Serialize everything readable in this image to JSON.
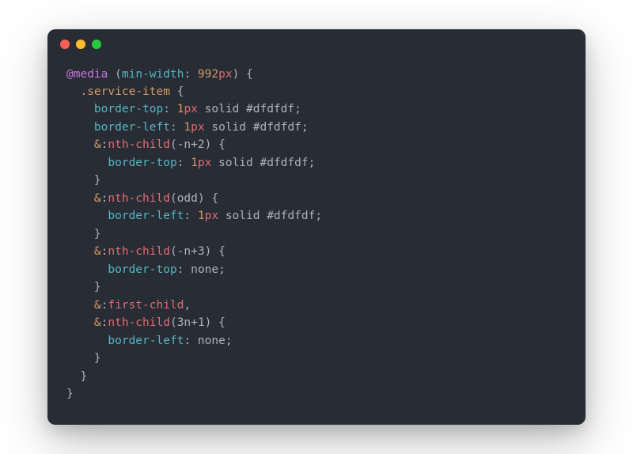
{
  "code": {
    "language": "scss",
    "tokens": [
      [
        [
          "tok-at",
          "@media"
        ],
        [
          "tok-punc",
          " ("
        ],
        [
          "tok-prop",
          "min-width"
        ],
        [
          "tok-punc",
          ": "
        ],
        [
          "tok-num",
          "992"
        ],
        [
          "tok-unit",
          "px"
        ],
        [
          "tok-punc",
          ") {"
        ]
      ],
      [
        [
          "tok-punc",
          "  "
        ],
        [
          "tok-class",
          ".service-item"
        ],
        [
          "tok-punc",
          " {"
        ]
      ],
      [
        [
          "tok-punc",
          "    "
        ],
        [
          "tok-prop",
          "border-top"
        ],
        [
          "tok-punc",
          ": "
        ],
        [
          "tok-num",
          "1"
        ],
        [
          "tok-unit",
          "px"
        ],
        [
          "tok-val",
          " solid "
        ],
        [
          "tok-color",
          "#dfdfdf"
        ],
        [
          "tok-punc",
          ";"
        ]
      ],
      [
        [
          "tok-punc",
          "    "
        ],
        [
          "tok-prop",
          "border-left"
        ],
        [
          "tok-punc",
          ": "
        ],
        [
          "tok-num",
          "1"
        ],
        [
          "tok-unit",
          "px"
        ],
        [
          "tok-val",
          " solid "
        ],
        [
          "tok-color",
          "#dfdfdf"
        ],
        [
          "tok-punc",
          ";"
        ]
      ],
      [
        [
          "tok-punc",
          "    "
        ],
        [
          "tok-amp",
          "&"
        ],
        [
          "tok-punc",
          ":"
        ],
        [
          "tok-pseudo",
          "nth-child"
        ],
        [
          "tok-paren",
          "("
        ],
        [
          "tok-val",
          "-n+2"
        ],
        [
          "tok-paren",
          ")"
        ],
        [
          "tok-punc",
          " {"
        ]
      ],
      [
        [
          "tok-punc",
          "      "
        ],
        [
          "tok-prop",
          "border-top"
        ],
        [
          "tok-punc",
          ": "
        ],
        [
          "tok-num",
          "1"
        ],
        [
          "tok-unit",
          "px"
        ],
        [
          "tok-val",
          " solid "
        ],
        [
          "tok-color",
          "#dfdfdf"
        ],
        [
          "tok-punc",
          ";"
        ]
      ],
      [
        [
          "tok-punc",
          "    }"
        ]
      ],
      [
        [
          "tok-punc",
          "    "
        ],
        [
          "tok-amp",
          "&"
        ],
        [
          "tok-punc",
          ":"
        ],
        [
          "tok-pseudo",
          "nth-child"
        ],
        [
          "tok-paren",
          "("
        ],
        [
          "tok-val",
          "odd"
        ],
        [
          "tok-paren",
          ")"
        ],
        [
          "tok-punc",
          " {"
        ]
      ],
      [
        [
          "tok-punc",
          "      "
        ],
        [
          "tok-prop",
          "border-left"
        ],
        [
          "tok-punc",
          ": "
        ],
        [
          "tok-num",
          "1"
        ],
        [
          "tok-unit",
          "px"
        ],
        [
          "tok-val",
          " solid "
        ],
        [
          "tok-color",
          "#dfdfdf"
        ],
        [
          "tok-punc",
          ";"
        ]
      ],
      [
        [
          "tok-punc",
          "    }"
        ]
      ],
      [
        [
          "tok-punc",
          "    "
        ],
        [
          "tok-amp",
          "&"
        ],
        [
          "tok-punc",
          ":"
        ],
        [
          "tok-pseudo",
          "nth-child"
        ],
        [
          "tok-paren",
          "("
        ],
        [
          "tok-val",
          "-n+3"
        ],
        [
          "tok-paren",
          ")"
        ],
        [
          "tok-punc",
          " {"
        ]
      ],
      [
        [
          "tok-punc",
          "      "
        ],
        [
          "tok-prop",
          "border-top"
        ],
        [
          "tok-punc",
          ": "
        ],
        [
          "tok-val",
          "none"
        ],
        [
          "tok-punc",
          ";"
        ]
      ],
      [
        [
          "tok-punc",
          "    }"
        ]
      ],
      [
        [
          "tok-punc",
          "    "
        ],
        [
          "tok-amp",
          "&"
        ],
        [
          "tok-punc",
          ":"
        ],
        [
          "tok-pseudo",
          "first-child"
        ],
        [
          "tok-punc",
          ","
        ]
      ],
      [
        [
          "tok-punc",
          "    "
        ],
        [
          "tok-amp",
          "&"
        ],
        [
          "tok-punc",
          ":"
        ],
        [
          "tok-pseudo",
          "nth-child"
        ],
        [
          "tok-paren",
          "("
        ],
        [
          "tok-val",
          "3n+1"
        ],
        [
          "tok-paren",
          ")"
        ],
        [
          "tok-punc",
          " {"
        ]
      ],
      [
        [
          "tok-punc",
          "      "
        ],
        [
          "tok-prop",
          "border-left"
        ],
        [
          "tok-punc",
          ": "
        ],
        [
          "tok-val",
          "none"
        ],
        [
          "tok-punc",
          ";"
        ]
      ],
      [
        [
          "tok-punc",
          "    }"
        ]
      ],
      [
        [
          "tok-punc",
          "  }"
        ]
      ],
      [
        [
          "tok-punc",
          "}"
        ]
      ]
    ]
  }
}
